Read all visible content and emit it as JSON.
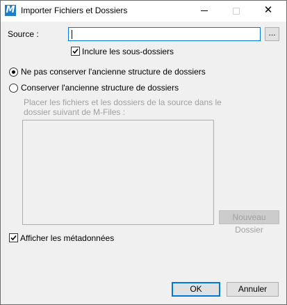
{
  "window": {
    "title": "Importer Fichiers et Dossiers",
    "app_icon_letter": "M"
  },
  "source": {
    "label": "Source :",
    "value": "",
    "browse_label": "..."
  },
  "include_subfolders": {
    "label": "Inclure les sous-dossiers",
    "checked": true
  },
  "structure_options": [
    {
      "label": "Ne pas conserver l'ancienne structure de dossiers",
      "selected": true
    },
    {
      "label": "Conserver l'ancienne structure de dossiers",
      "selected": false
    }
  ],
  "placement": {
    "hint_line1": "Placer les fichiers et les dossiers de la source dans le",
    "hint_line2": "dossier suivant de M-Files :",
    "new_folder_label": "Nouveau Dossier"
  },
  "show_metadata": {
    "label": "Afficher les métadonnées",
    "checked": true
  },
  "footer": {
    "ok_label": "OK",
    "cancel_label": "Annuler"
  },
  "colors": {
    "accent": "#0078d7",
    "app_icon": "#1e7fc8",
    "disabled_text": "#a0a0a0"
  }
}
